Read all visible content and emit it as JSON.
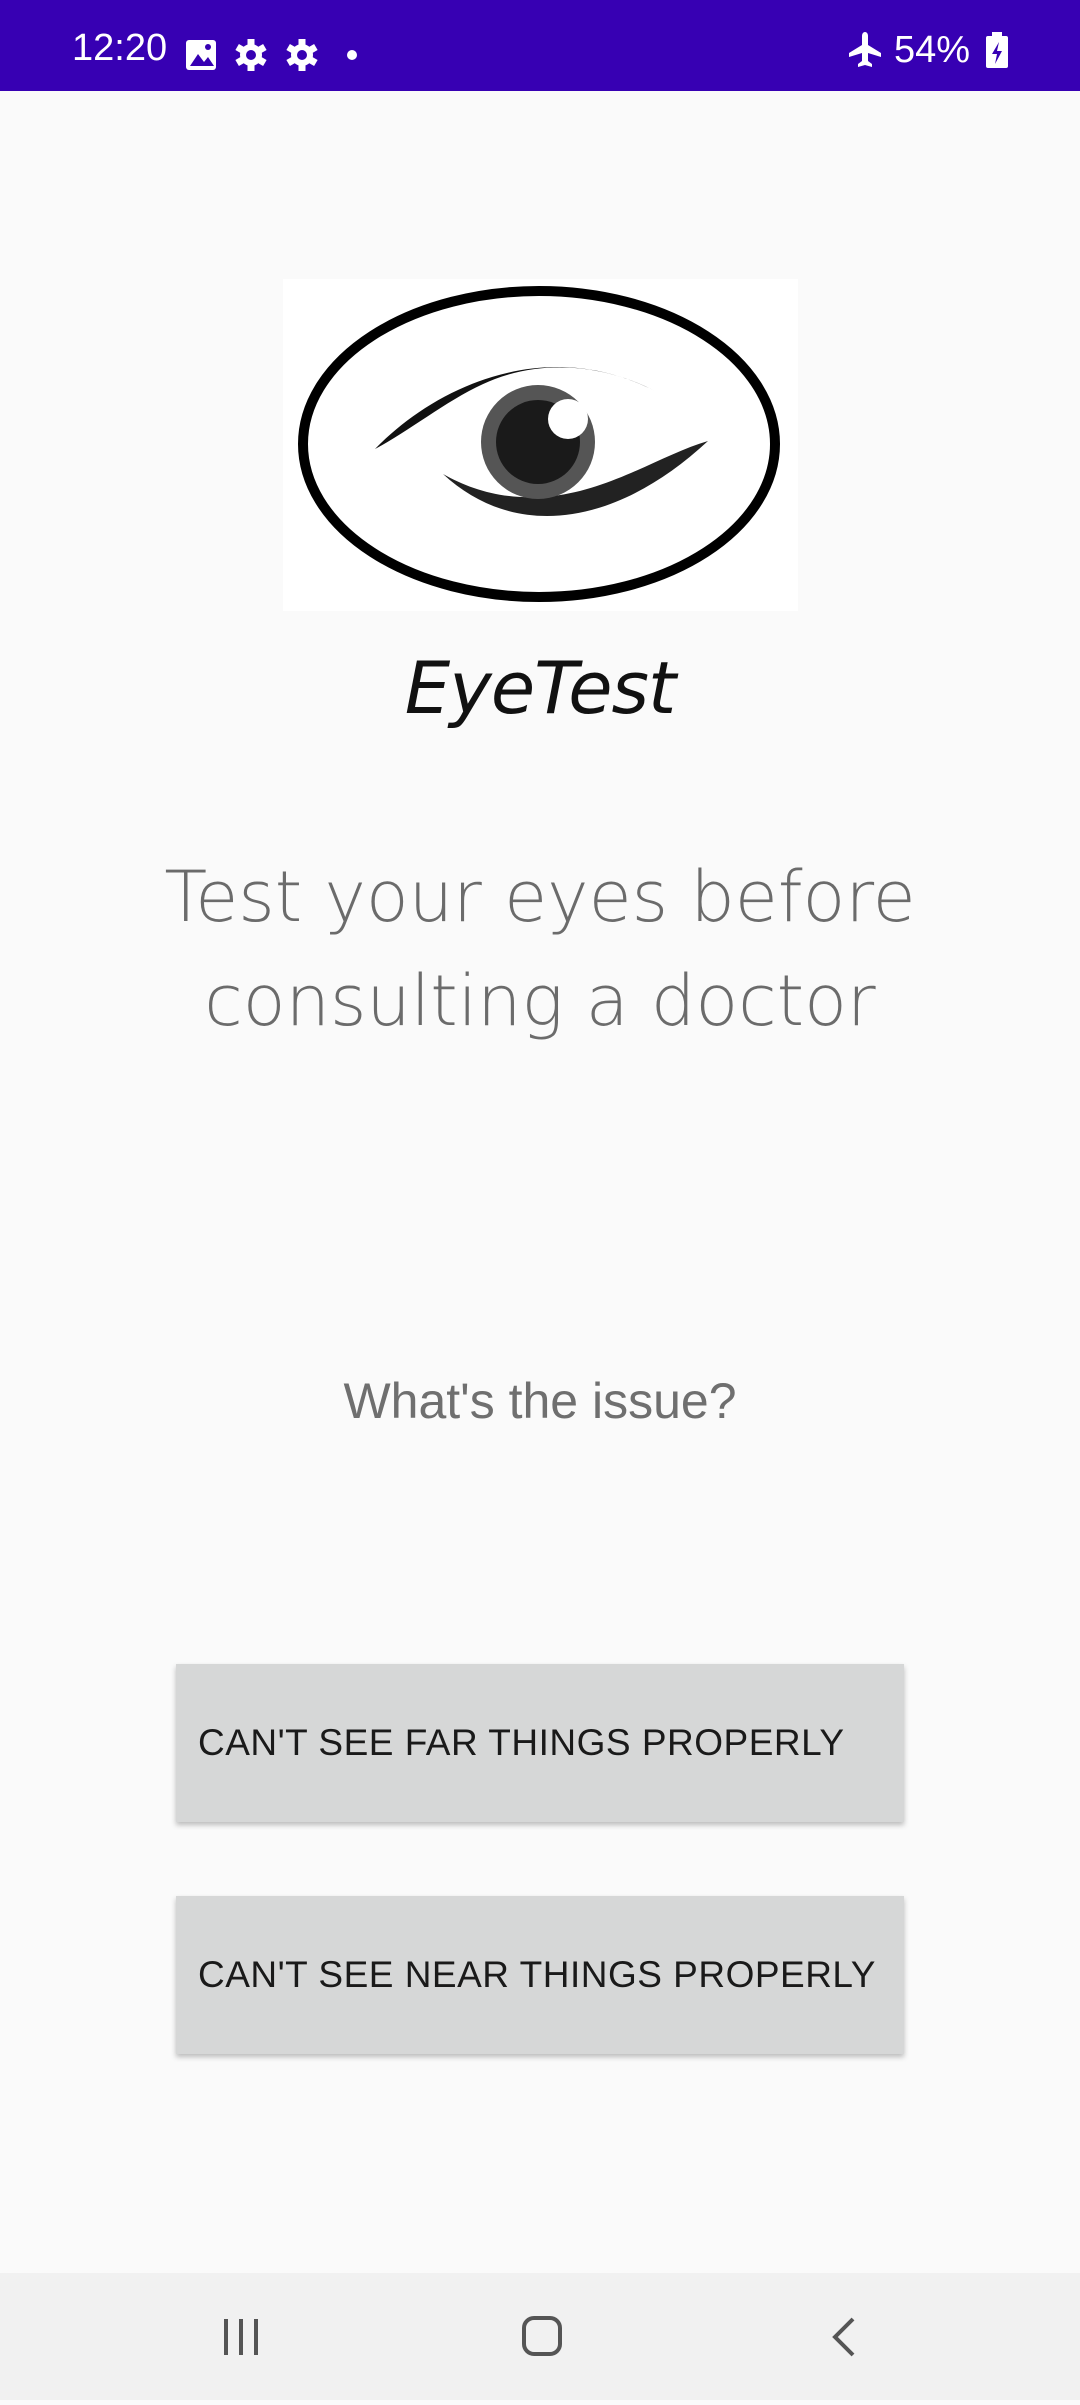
{
  "status_bar": {
    "time": "12:20",
    "battery": "54%",
    "background_color": "#3700b3",
    "icons": [
      "image-icon",
      "gear-icon",
      "gear-icon",
      "dot-icon",
      "airplane-mode-icon",
      "battery-charging-icon"
    ]
  },
  "app": {
    "logo_icon": "eye-logo",
    "name": "EyeTest",
    "tagline": "Test your eyes before consulting a doctor",
    "question": "What's the issue?"
  },
  "buttons": {
    "far": "CAN'T SEE FAR THINGS PROPERLY",
    "near": "CAN'T SEE NEAR THINGS PROPERLY"
  },
  "nav_bar": {
    "icons": [
      "recent-apps-icon",
      "home-icon",
      "back-icon"
    ]
  }
}
